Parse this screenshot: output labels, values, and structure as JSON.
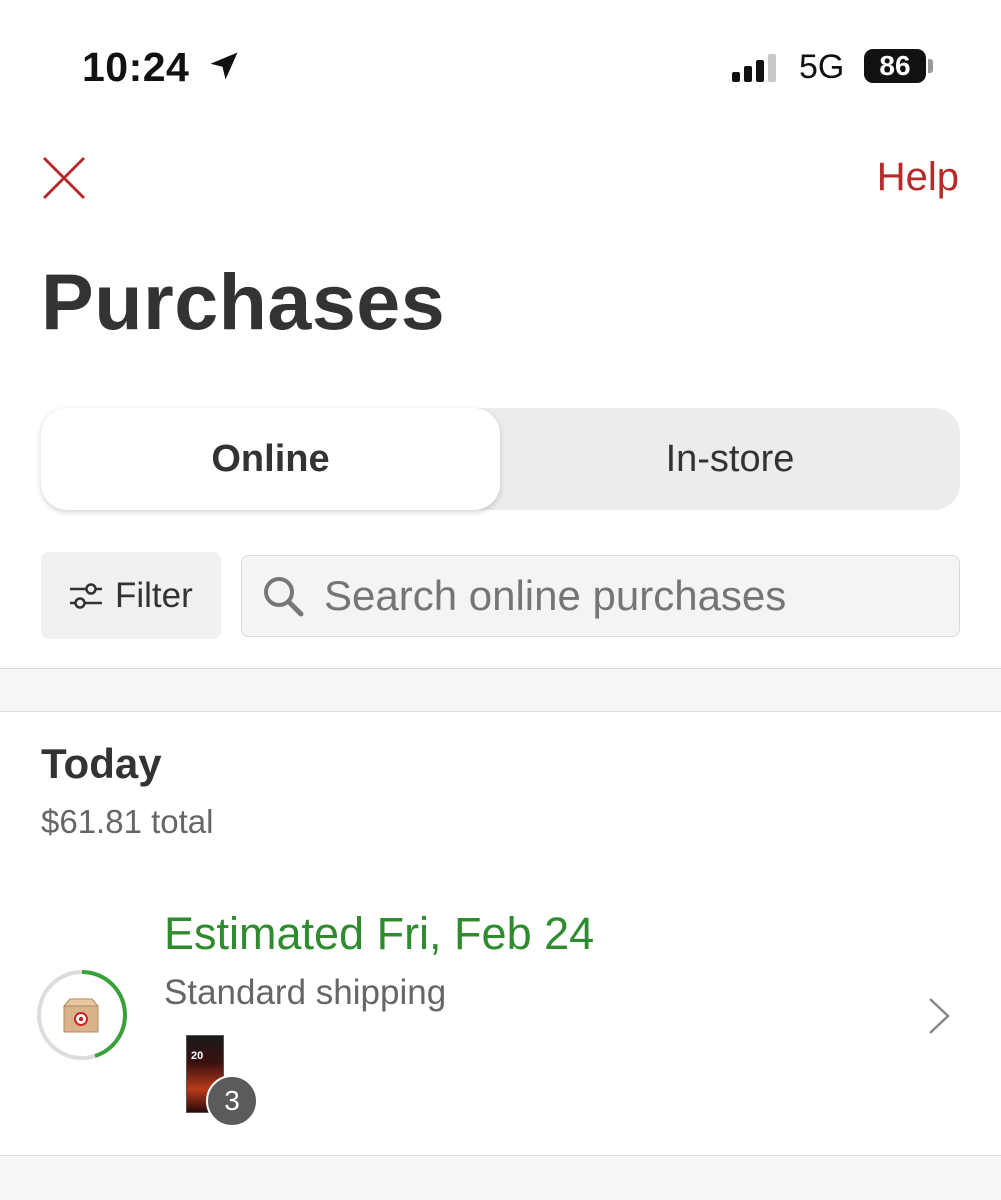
{
  "status_bar": {
    "time": "10:24",
    "network": "5G",
    "battery": "86",
    "icons": [
      "location-arrow-icon",
      "signal-bars-icon",
      "battery-icon"
    ]
  },
  "header": {
    "close_icon": "close-icon",
    "help_label": "Help",
    "title": "Purchases"
  },
  "tabs": [
    {
      "label": "Online",
      "selected": true
    },
    {
      "label": "In-store",
      "selected": false
    }
  ],
  "filter": {
    "label": "Filter",
    "icon": "sliders-icon"
  },
  "search": {
    "placeholder": "Search online purchases",
    "value": "",
    "icon": "search-icon"
  },
  "section": {
    "title": "Today",
    "total": "$61.81 total"
  },
  "order": {
    "estimate": "Estimated Fri, Feb 24",
    "shipping": "Standard shipping",
    "quantity": "3",
    "progress": 0.45,
    "status_icon": "package-box-icon",
    "chevron_icon": "chevron-right-icon"
  },
  "colors": {
    "brand_red": "#b82a2a",
    "success_green": "#2e8b2e",
    "text": "#333333"
  }
}
